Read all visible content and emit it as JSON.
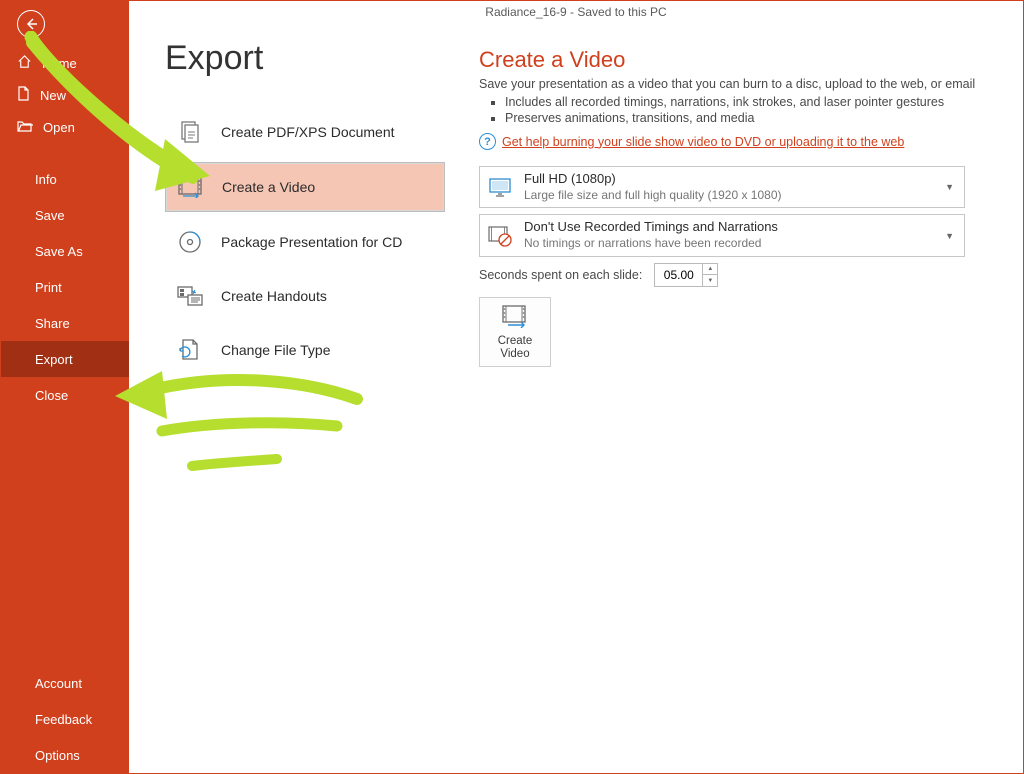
{
  "document": {
    "title": "Radiance_16-9  -  Saved to this PC"
  },
  "colors": {
    "accent": "#d0401d",
    "annotation": "#b6de2f"
  },
  "nav": {
    "home": "Home",
    "new_": "New",
    "open": "Open",
    "info": "Info",
    "save": "Save",
    "save_as": "Save As",
    "print": "Print",
    "share": "Share",
    "export": "Export",
    "close": "Close",
    "account": "Account",
    "feedback": "Feedback",
    "options": "Options"
  },
  "page": {
    "heading": "Export"
  },
  "export_options": {
    "pdf": "Create PDF/XPS Document",
    "video": "Create a Video",
    "cd": "Package Presentation for CD",
    "handouts": "Create Handouts",
    "filetype": "Change File Type"
  },
  "details": {
    "heading": "Create a Video",
    "lead": "Save your presentation as a video that you can burn to a disc, upload to the web, or email",
    "bullet1": "Includes all recorded timings, narrations, ink strokes, and laser pointer gestures",
    "bullet2": "Preserves animations, transitions, and media",
    "help_link": "Get help burning your slide show video to DVD or uploading it to the web",
    "quality": {
      "title": "Full HD (1080p)",
      "desc": "Large file size and full high quality (1920 x 1080)"
    },
    "timings": {
      "title": "Don't Use Recorded Timings and Narrations",
      "desc": "No timings or narrations have been recorded"
    },
    "seconds_label": "Seconds spent on each slide:",
    "seconds_value": "05.00",
    "button_label_line1": "Create",
    "button_label_line2": "Video"
  }
}
